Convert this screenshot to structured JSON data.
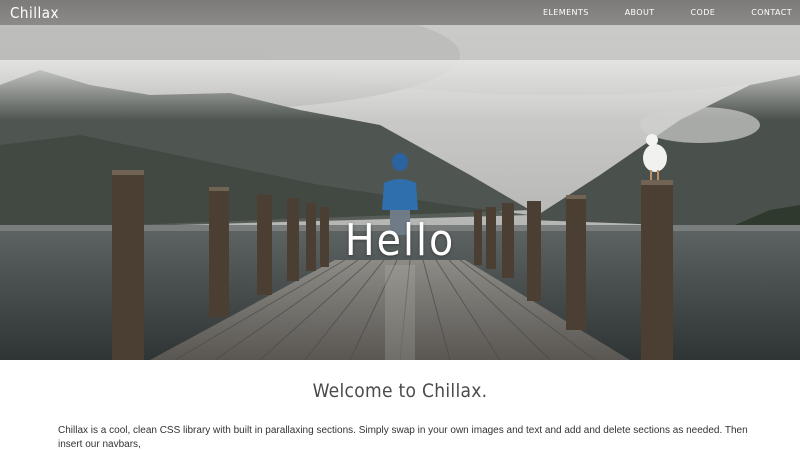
{
  "navbar": {
    "brand": "Chillax",
    "links": [
      "ELEMENTS",
      "ABOUT",
      "CODE",
      "CONTACT"
    ]
  },
  "hero": {
    "title": "Hello"
  },
  "content": {
    "heading": "Welcome to Chillax.",
    "body": "Chillax is a cool, clean CSS library with built in parallaxing sections. Simply swap in your own images and text and add and delete sections as needed. Then insert our navbars,"
  },
  "colors": {
    "navbar_bg": "#8a8886",
    "heading_text": "#4a4a4a",
    "body_text": "#333333"
  }
}
